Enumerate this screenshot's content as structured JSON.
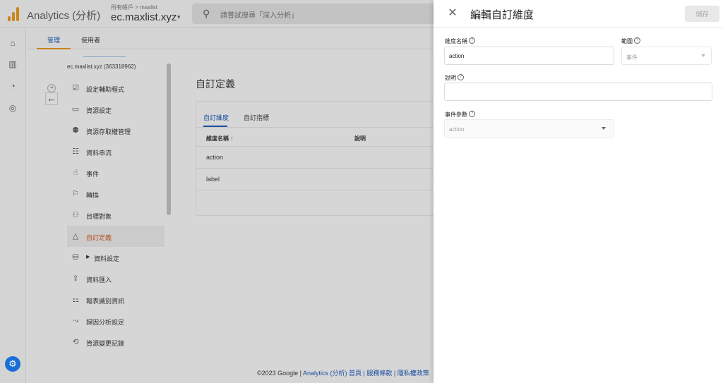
{
  "app": {
    "name": "Analytics (分析)",
    "account_breadcrumb": "所有帳戶 > maxlist",
    "account_name": "ec.maxlist.xyz",
    "search_placeholder": "請嘗試搜尋「深入分析」"
  },
  "admin_tabs": [
    "管理",
    "使用者"
  ],
  "nav": {
    "property_id": "ec.maxlist.xyz (363318962)",
    "items": [
      {
        "label": "設定輔助程式",
        "icon": "checklist-icon"
      },
      {
        "label": "資源設定",
        "icon": "property-settings-icon"
      },
      {
        "label": "資源存取權管理",
        "icon": "people-icon"
      },
      {
        "label": "資料串流",
        "icon": "data-stream-icon"
      },
      {
        "label": "事件",
        "icon": "touch-icon"
      },
      {
        "label": "轉換",
        "icon": "flag-icon"
      },
      {
        "label": "目標對象",
        "icon": "audience-icon"
      },
      {
        "label": "自訂定義",
        "icon": "shapes-icon"
      },
      {
        "label": "資料設定",
        "icon": "database-icon"
      },
      {
        "label": "資料匯入",
        "icon": "upload-icon"
      },
      {
        "label": "報表識別資訊",
        "icon": "report-identity-icon"
      },
      {
        "label": "歸因分析設定",
        "icon": "attribution-icon"
      },
      {
        "label": "資源變更記錄",
        "icon": "history-icon"
      }
    ]
  },
  "main": {
    "title": "自訂定義",
    "tabs": [
      "自訂維度",
      "自訂指標"
    ],
    "columns": [
      "維度名稱 ↑",
      "說明"
    ],
    "rows": [
      "action",
      "label"
    ]
  },
  "footer": {
    "copyright": "©2023 Google | ",
    "links": "Analytics (分析) 首頁 | 服務條款 | 隱私權政策"
  },
  "panel": {
    "title": "編輯自訂維度",
    "save_label": "儲存",
    "dimension_name_label": "維度名稱",
    "dimension_name_value": "action",
    "scope_label": "範圍",
    "scope_value": "事件",
    "description_label": "說明",
    "description_value": "",
    "event_param_label": "事件參數",
    "event_param_value": "action"
  },
  "colors": {
    "accent": "#1a73e8",
    "active_nav": "#b84a18",
    "logo": "#e37400"
  }
}
